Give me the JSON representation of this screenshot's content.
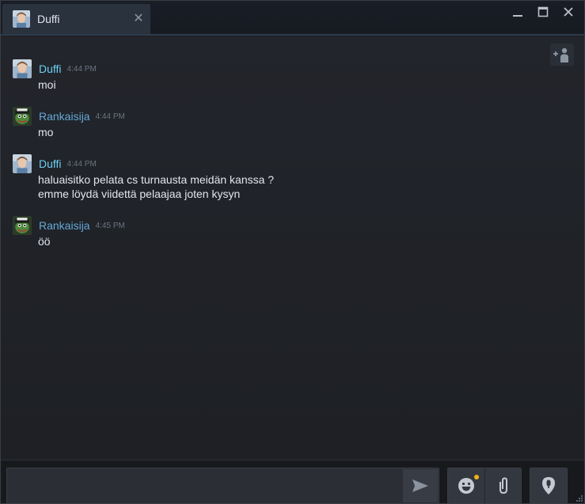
{
  "tab": {
    "name": "Duffi",
    "close_glyph": "✕"
  },
  "window_controls": {
    "minimize": "minimize",
    "maximize": "maximize",
    "close": "close"
  },
  "messages": [
    {
      "sender": "Duffi",
      "time": "4:44 PM",
      "lines": [
        "moi"
      ],
      "avatar": "duffi"
    },
    {
      "sender": "Rankaisija",
      "time": "4:44 PM",
      "lines": [
        "mo"
      ],
      "avatar": "rankaisija"
    },
    {
      "sender": "Duffi",
      "time": "4:44 PM",
      "lines": [
        "haluaisitko pelata cs turnausta meidän kanssa ?",
        "emme löydä viidettä pelaajaa joten kysyn"
      ],
      "avatar": "duffi"
    },
    {
      "sender": "Rankaisija",
      "time": "4:45 PM",
      "lines": [
        "öö"
      ],
      "avatar": "rankaisija"
    }
  ],
  "input": {
    "placeholder": "",
    "value": ""
  },
  "colors": {
    "accent_name_duffi": "#6dcff6",
    "accent_name_rankaisija": "#65a8d8",
    "notification_dot": "#f0b21a"
  },
  "icons": [
    "add-friend-icon",
    "send-icon",
    "emoji-icon",
    "attachment-icon",
    "voice-icon"
  ]
}
